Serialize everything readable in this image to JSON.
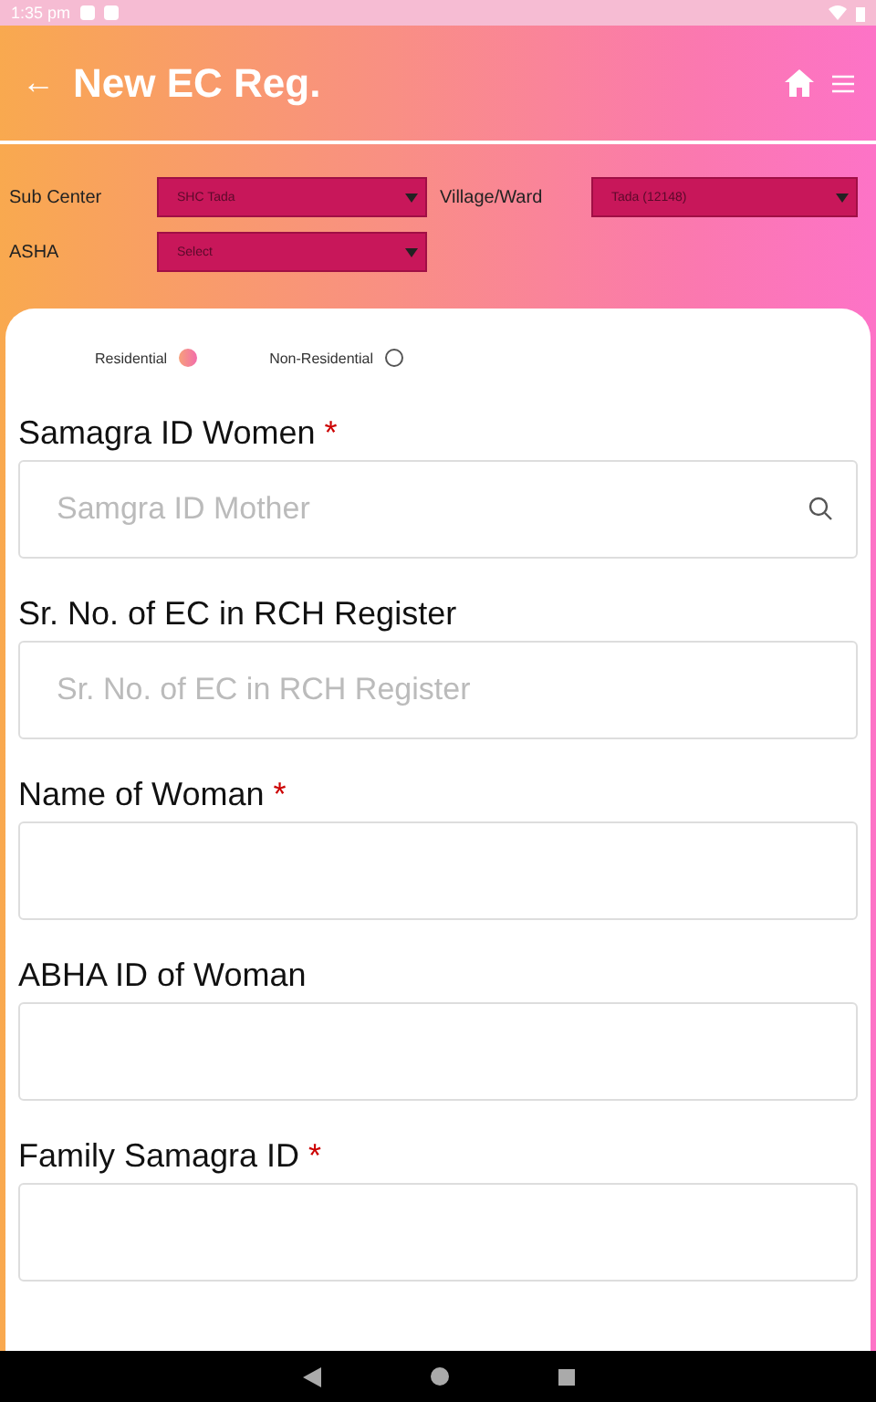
{
  "status_bar": {
    "time": "1:35 pm"
  },
  "header": {
    "back": "←",
    "title": "New EC Reg."
  },
  "filters": [
    {
      "label": "Sub Center",
      "value": "SHC Tada"
    },
    {
      "label": "Village/Ward",
      "value": "Tada (12148)"
    },
    {
      "label": "ASHA",
      "value": "Select"
    }
  ],
  "residence": [
    {
      "label": "Residential",
      "selected": true
    },
    {
      "label": "Non-Residential",
      "selected": false
    }
  ],
  "fields": [
    {
      "label": "Samagra ID Women",
      "required_mark": "*",
      "placeholder": "Samgra ID Mother",
      "search": true
    },
    {
      "label": "Sr. No. of EC in RCH Register",
      "placeholder": "Sr. No. of EC in RCH Register",
      "search": false
    },
    {
      "label": "Name of Woman",
      "required_mark": "*",
      "search": false
    },
    {
      "label": "ABHA ID of Woman",
      "search": false
    },
    {
      "label": "Family Samagra ID",
      "required_mark": "*",
      "search": false
    }
  ]
}
